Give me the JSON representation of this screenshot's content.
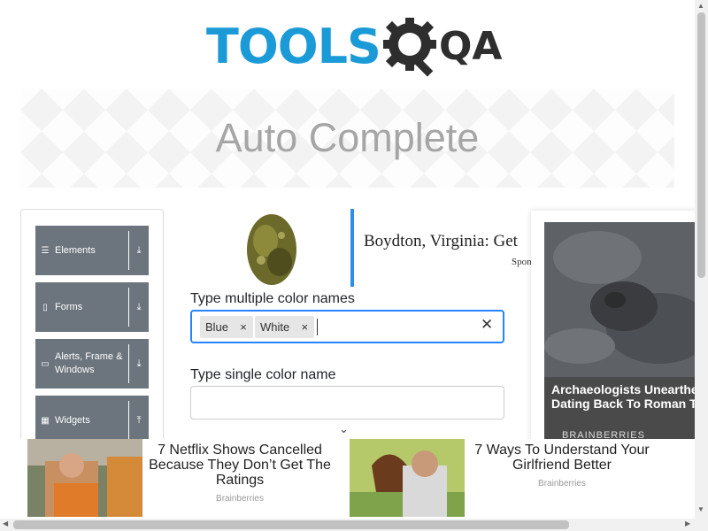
{
  "header": {
    "logo_text": "TOOLS",
    "logo_qa": "QA"
  },
  "banner": {
    "title": "Auto Complete"
  },
  "sidebar": {
    "items": [
      {
        "label": "Elements",
        "icon": "list-icon",
        "arrow": "⤓"
      },
      {
        "label": "Forms",
        "icon": "form-icon",
        "arrow": "⤓"
      },
      {
        "label": "Alerts, Frame & Windows",
        "icon": "window-icon",
        "arrow": "⤓"
      },
      {
        "label": "Widgets",
        "icon": "grid-icon",
        "arrow": "⤒"
      }
    ]
  },
  "top_ad": {
    "title": "Boydton, Virginia: Get",
    "sponsor": "Spon"
  },
  "form": {
    "multi_label": "Type multiple color names",
    "chips": [
      "Blue",
      "White"
    ],
    "single_label": "Type single color name"
  },
  "right_ad": {
    "title": "Archaeologists Unearthed Dating Back To Roman Ti",
    "brand": "BRAINBERRIES"
  },
  "bottom_ad": {
    "ad1_title": "7 Netflix Shows Cancelled Because They Don’t Get The Ratings",
    "ad1_source": "Brainberries",
    "ad2_title": "7 Ways To Understand Your Girlfriend Better",
    "ad2_source": "Brainberries"
  },
  "icons": {
    "chip_remove": "×",
    "clear": "✕",
    "chevron": "⌄"
  }
}
